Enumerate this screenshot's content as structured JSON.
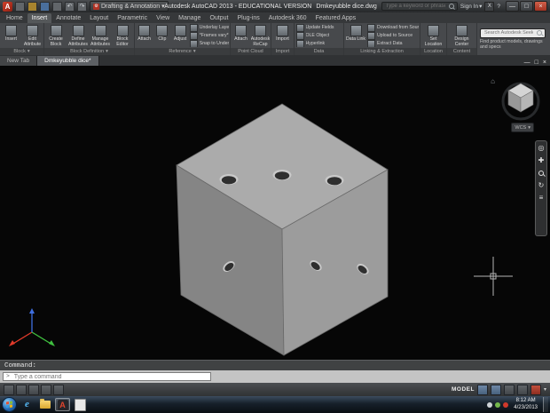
{
  "window": {
    "title_left": "Autodesk AutoCAD 2013 - EDUCATIONAL VERSION",
    "title_doc": "Dmkeyubble dice.dwg",
    "workspace": "Drafting & Annotation",
    "search_placeholder": "Type a keyword or phrase",
    "signin_label": "Sign In"
  },
  "icons": {
    "caret": "▾",
    "minimize": "—",
    "maximize": "□",
    "close": "×",
    "undo": "↶",
    "redo": "↷",
    "home": "⌂",
    "wheel": "◎",
    "pan": "✚",
    "orbit": "↻",
    "menu": "≡",
    "gear": "⚙",
    "help": "?",
    "exchange": "X",
    "prompt": ">"
  },
  "ribbon": {
    "active_tab": "Insert",
    "tabs": [
      {
        "label": "Home"
      },
      {
        "label": "Insert"
      },
      {
        "label": "Annotate"
      },
      {
        "label": "Layout"
      },
      {
        "label": "Parametric"
      },
      {
        "label": "View"
      },
      {
        "label": "Manage"
      },
      {
        "label": "Output"
      },
      {
        "label": "Plug-ins"
      },
      {
        "label": "Autodesk 360"
      },
      {
        "label": "Featured Apps"
      }
    ],
    "panels": {
      "block": {
        "title": "Block",
        "buttons": [
          {
            "label": "Insert"
          },
          {
            "label": "Edit Attribute"
          }
        ]
      },
      "block_definition": {
        "title": "Block Definition",
        "buttons": [
          {
            "label": "Create Block"
          },
          {
            "label": "Define Attributes"
          },
          {
            "label": "Manage Attributes"
          },
          {
            "label": "Block Editor"
          }
        ]
      },
      "reference": {
        "title": "Reference",
        "buttons": [
          {
            "label": "Attach"
          },
          {
            "label": "Clip"
          },
          {
            "label": "Adjust"
          }
        ],
        "rows": [
          {
            "label": "Underlay Layers"
          },
          {
            "label": "*Frames vary*"
          },
          {
            "label": "Snap to Underlays ON"
          }
        ]
      },
      "point_cloud": {
        "title": "Point Cloud",
        "buttons": [
          {
            "label": "Attach"
          },
          {
            "label": "Autodesk ReCap"
          }
        ]
      },
      "import": {
        "title": "Import",
        "buttons": [
          {
            "label": "Import"
          }
        ]
      },
      "data": {
        "title": "Data",
        "rows": [
          {
            "label": "Update Fields"
          },
          {
            "label": "OLE Object"
          },
          {
            "label": "Hyperlink"
          }
        ]
      },
      "linking": {
        "title": "Linking & Extraction",
        "buttons": [
          {
            "label": "Data Link"
          }
        ],
        "rows": [
          {
            "label": "Download from Source"
          },
          {
            "label": "Upload to Source"
          },
          {
            "label": "Extract Data"
          }
        ]
      },
      "location": {
        "title": "Location",
        "buttons": [
          {
            "label": "Set Location"
          }
        ]
      },
      "content": {
        "title": "Content",
        "buttons": [
          {
            "label": "Design Center"
          }
        ]
      },
      "seek": {
        "search_placeholder": "Search Autodesk Seek",
        "caption": "Find product models, drawings and specs"
      }
    }
  },
  "file_tabs": [
    {
      "label": "New Tab"
    },
    {
      "label": "Dmkeyubble dice*"
    }
  ],
  "canvas": {
    "viewcube_wcs_label": "WCS",
    "colors": {
      "background": "#060606",
      "crosshair": "#b4b4b4"
    }
  },
  "dice": {
    "description": "3D solid cube with drilled pips (dice)",
    "colors": {
      "top_face": "#ababab",
      "left_face": "#858585",
      "right_face": "#9c9c9c",
      "edge": "#6a6a6a",
      "hole": "#2f2f2f",
      "hole_rim": "#c9c9c9"
    }
  },
  "command_line": {
    "history": "Command:",
    "input_placeholder": "Type a command"
  },
  "status_bar": {
    "model_label": "MODEL"
  },
  "taskbar": {
    "clock_time": "8:12 AM",
    "clock_date": "4/23/2013"
  }
}
